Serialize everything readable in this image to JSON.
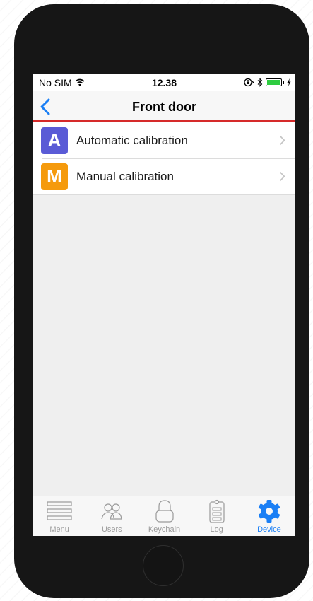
{
  "status_bar": {
    "carrier": "No SIM",
    "time": "12.38",
    "icons": [
      "wifi-icon",
      "orientation-lock-icon",
      "bluetooth-icon",
      "battery-charging-icon"
    ]
  },
  "nav": {
    "title": "Front door",
    "back_icon": "chevron-left-icon",
    "accent_color": "#d62a2a"
  },
  "list": {
    "items": [
      {
        "badge": "A",
        "label": "Automatic calibration",
        "badge_color": "#5a5bd6"
      },
      {
        "badge": "M",
        "label": "Manual calibration",
        "badge_color": "#f59a0c"
      }
    ]
  },
  "tabs": [
    {
      "label": "Menu",
      "icon": "menu-icon",
      "active": false
    },
    {
      "label": "Users",
      "icon": "users-icon",
      "active": false
    },
    {
      "label": "Keychain",
      "icon": "lock-icon",
      "active": false
    },
    {
      "label": "Log",
      "icon": "clipboard-icon",
      "active": false
    },
    {
      "label": "Device",
      "icon": "gear-icon",
      "active": true
    }
  ],
  "colors": {
    "tab_active": "#1a7ff5",
    "tab_inactive": "#9a9a9a"
  }
}
